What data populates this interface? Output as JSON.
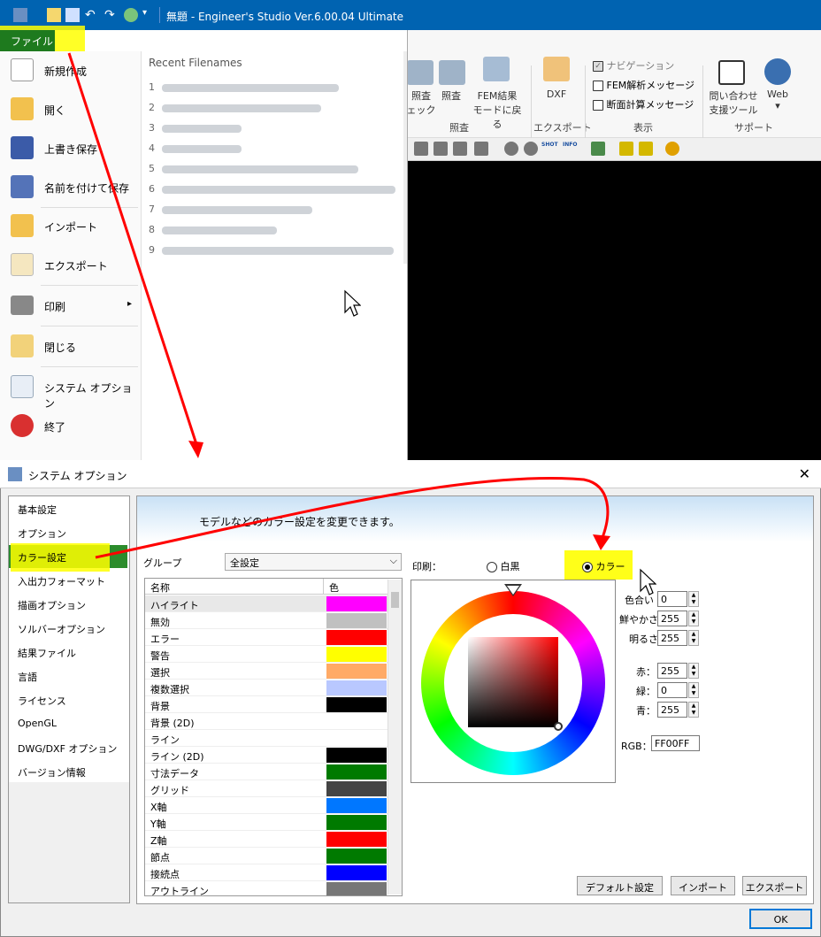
{
  "app": {
    "title": "無題 - Engineer's Studio Ver.6.00.04 Ultimate"
  },
  "ribbon": {
    "buttons": [
      {
        "label1": "照査",
        "label2": "ェック"
      },
      {
        "label1": "照査",
        "label2": ""
      },
      {
        "label1": "FEM結果",
        "label2": "モードに戻る"
      },
      {
        "label1": "DXF",
        "label2": ""
      }
    ],
    "groups": [
      "照査",
      "エクスポート",
      "表示",
      "サポート"
    ],
    "checks": [
      {
        "label": "ナビゲーション",
        "checked": true
      },
      {
        "label": "FEM解析メッセージ",
        "checked": false
      },
      {
        "label": "断面計算メッセージ",
        "checked": false
      }
    ],
    "support": {
      "contact1": "問い合わせ",
      "contact2": "支援ツール",
      "web": "Web",
      "web_arrow": "▾"
    },
    "toolbar_labels": {
      "shot": "SHOT",
      "info": "INFO"
    }
  },
  "file_menu": {
    "tab_label": "ファイル",
    "items": [
      {
        "label": "新規作成",
        "icon": "new-document-icon"
      },
      {
        "label": "開く",
        "icon": "open-folder-icon"
      },
      {
        "label": "上書き保存",
        "icon": "save-icon"
      },
      {
        "label": "名前を付けて保存",
        "icon": "save-as-icon"
      },
      {
        "label": "インポート",
        "icon": "import-icon"
      },
      {
        "label": "エクスポート",
        "icon": "export-icon"
      },
      {
        "label": "印刷",
        "icon": "printer-icon",
        "arrow": "▸"
      },
      {
        "label": "閉じる",
        "icon": "close-document-icon"
      },
      {
        "label": "システム オプション",
        "icon": "system-options-icon"
      },
      {
        "label": "終了",
        "icon": "exit-icon"
      }
    ],
    "recent_header": "Recent Filenames",
    "recent_numbers": [
      "1",
      "2",
      "3",
      "4",
      "5",
      "6",
      "7",
      "8",
      "9"
    ]
  },
  "dialog": {
    "title": "システム オプション",
    "close": "✕",
    "nav": [
      "基本設定",
      "オプション",
      "カラー設定",
      "入出力フォーマット",
      "描画オプション",
      "ソルバーオプション",
      "結果ファイル",
      "言語",
      "ライセンス",
      "OpenGL",
      "DWG/DXF オプション",
      "バージョン情報"
    ],
    "banner": "モデルなどのカラー設定を変更できます。",
    "group_label": "グループ",
    "group_value": "全設定",
    "group_arrow": "⌵",
    "table": {
      "col_name": "名称",
      "col_color": "色",
      "rows": [
        {
          "name": "ハイライト",
          "color": "#ff00ff"
        },
        {
          "name": "無効",
          "color": "#c0c0c0"
        },
        {
          "name": "エラー",
          "color": "#ff0000"
        },
        {
          "name": "警告",
          "color": "#ffff00"
        },
        {
          "name": "選択",
          "color": "#ffaa66"
        },
        {
          "name": "複数選択",
          "color": "#b9c8ff"
        },
        {
          "name": "背景",
          "color": "#000000"
        },
        {
          "name": "背景 (2D)",
          "color": "#ffffff"
        },
        {
          "name": "ライン",
          "color": "#ffffff"
        },
        {
          "name": "ライン (2D)",
          "color": "#000000"
        },
        {
          "name": "寸法データ",
          "color": "#007a00"
        },
        {
          "name": "グリッド",
          "color": "#444444"
        },
        {
          "name": "X軸",
          "color": "#0077ff"
        },
        {
          "name": "Y軸",
          "color": "#007a00"
        },
        {
          "name": "Z軸",
          "color": "#ff0000"
        },
        {
          "name": "節点",
          "color": "#007a00"
        },
        {
          "name": "接続点",
          "color": "#0000ff"
        },
        {
          "name": "アウトライン",
          "color": "#777777"
        }
      ]
    },
    "print_label": "印刷：",
    "print_options": [
      {
        "label": "白黒",
        "selected": false
      },
      {
        "label": "カラー",
        "selected": true
      }
    ],
    "fields": {
      "hue": {
        "label": "色合い",
        "value": "0"
      },
      "saturation": {
        "label": "鮮やかさ",
        "value": "255"
      },
      "brightness": {
        "label": "明るさ",
        "value": "255"
      },
      "red": {
        "label": "赤：",
        "value": "255"
      },
      "green": {
        "label": "緑：",
        "value": "0"
      },
      "blue": {
        "label": "青：",
        "value": "255"
      },
      "rgb": {
        "label": "RGB：",
        "value": "FF00FF"
      }
    },
    "buttons": {
      "default": "デフォルト設定",
      "import": "インポート",
      "export": "エクスポート",
      "ok": "OK"
    }
  },
  "colors": {
    "accent": "#0063b1",
    "selected_nav": "#2c8c2c",
    "highlight": "#ffff00",
    "annotation_arrow": "#ff0000"
  }
}
